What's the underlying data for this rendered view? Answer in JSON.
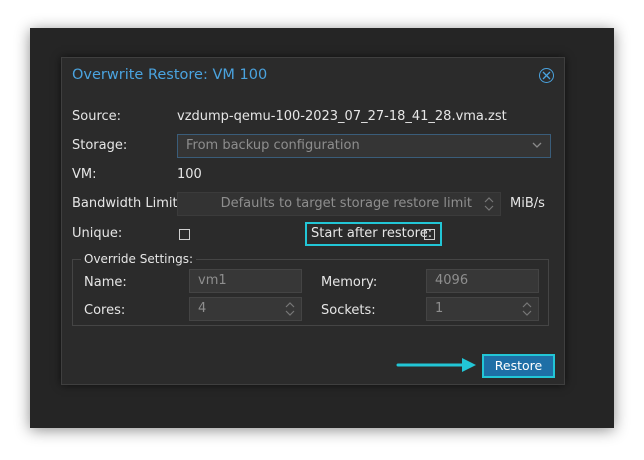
{
  "dialog": {
    "title": "Overwrite Restore: VM 100"
  },
  "form": {
    "source_label": "Source:",
    "source_value": "vzdump-qemu-100-2023_07_27-18_41_28.vma.zst",
    "storage_label": "Storage:",
    "storage_value": "From backup configuration",
    "vm_label": "VM:",
    "vm_value": "100",
    "bandwidth_label": "Bandwidth Limit:",
    "bandwidth_placeholder": "Defaults to target storage restore limit",
    "bandwidth_unit": "MiB/s",
    "unique_label": "Unique:",
    "start_after_label": "Start after restore:"
  },
  "override": {
    "legend": "Override Settings:",
    "name_label": "Name:",
    "name_value": "vm1",
    "memory_label": "Memory:",
    "memory_value": "4096",
    "cores_label": "Cores:",
    "cores_value": "4",
    "sockets_label": "Sockets:",
    "sockets_value": "1"
  },
  "actions": {
    "restore_label": "Restore"
  },
  "colors": {
    "accent": "#4aa3df",
    "highlight": "#22c6d6",
    "button": "#1e6fa6",
    "dialog_bg": "#2b2b2b"
  }
}
